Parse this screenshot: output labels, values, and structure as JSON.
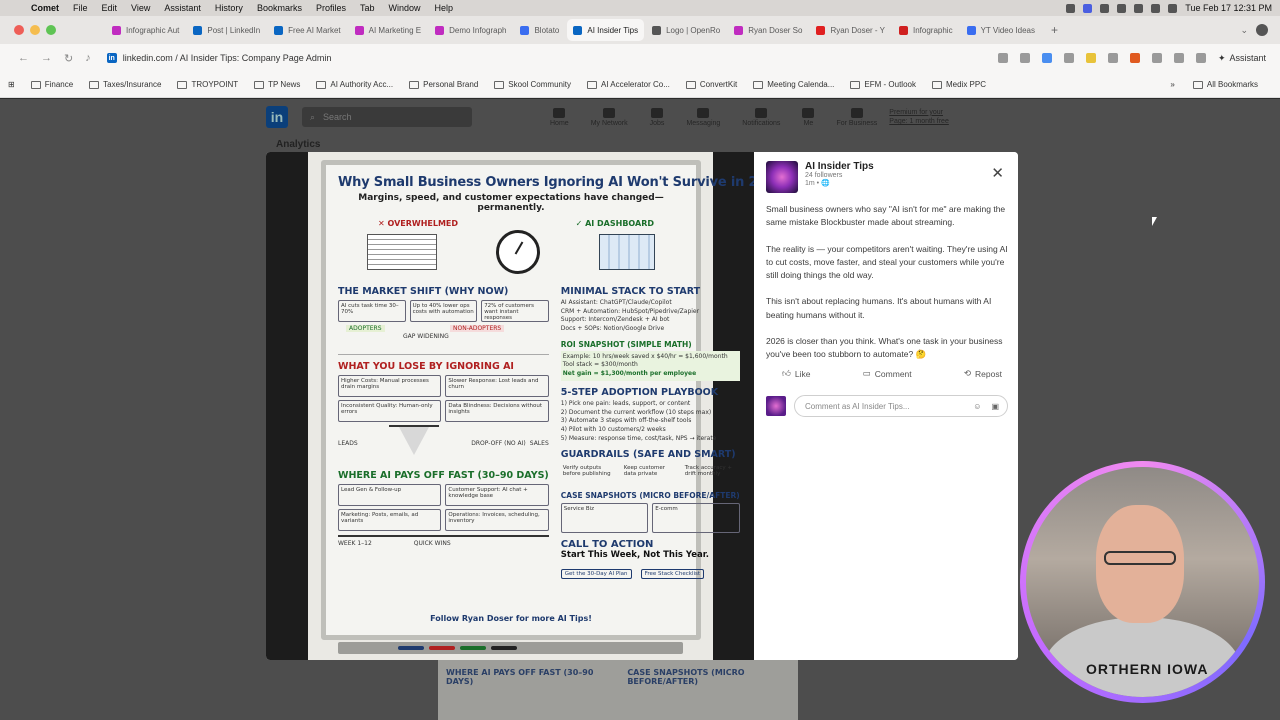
{
  "menubar": {
    "app": "Comet",
    "items": [
      "File",
      "Edit",
      "View",
      "Assistant",
      "History",
      "Bookmarks",
      "Profiles",
      "Tab",
      "Window",
      "Help"
    ],
    "clock": "Tue Feb 17  12:31 PM"
  },
  "tabs": [
    {
      "label": "Infographic Aut",
      "color": "#c02cc0"
    },
    {
      "label": "Post | LinkedIn",
      "color": "#0a66c2"
    },
    {
      "label": "Free AI Market",
      "color": "#0a66c2"
    },
    {
      "label": "AI Marketing E",
      "color": "#c02cc0"
    },
    {
      "label": "Demo Infograph",
      "color": "#c02cc0"
    },
    {
      "label": "Blotato",
      "color": "#3a6df0"
    },
    {
      "label": "AI Insider Tips",
      "color": "#0a66c2",
      "active": true
    },
    {
      "label": "Logo | OpenRo",
      "color": "#555555"
    },
    {
      "label": "Ryan Doser So",
      "color": "#c02cc0"
    },
    {
      "label": "Ryan Doser - Y",
      "color": "#e02020"
    },
    {
      "label": "Infographic",
      "color": "#d02020"
    },
    {
      "label": "YT Video Ideas",
      "color": "#3a6df0"
    }
  ],
  "url": "linkedin.com / AI Insider Tips: Company Page Admin",
  "assistant_label": "Assistant",
  "bookmarks": [
    "Finance",
    "Taxes/Insurance",
    "TROYPOINT",
    "TP News",
    "AI Authority Acc...",
    "Personal Brand",
    "Skool Community",
    "AI Accelerator Co...",
    "ConvertKit",
    "Meeting Calenda...",
    "EFM - Outlook",
    "Medix PPC"
  ],
  "all_bookmarks": "All Bookmarks",
  "linkedin": {
    "search_placeholder": "Search",
    "nav": [
      "Home",
      "My Network",
      "Jobs",
      "Messaging",
      "Notifications",
      "Me",
      "For Business"
    ],
    "premium_line1": "Premium for your",
    "premium_line2": "Page: 1 month free",
    "analytics": "Analytics"
  },
  "infographic": {
    "title": "Why Small Business Owners Ignoring AI Won't Survive in 2026",
    "subtitle": "Margins, speed, and customer expectations have changed—permanently.",
    "overwhelmed": "✕ OVERWHELMED",
    "dashboard": "✓ AI DASHBOARD",
    "market_shift": "THE MARKET SHIFT (WHY NOW)",
    "market_boxes": [
      "AI cuts task time 30–70%",
      "Up to 40% lower ops costs with automation",
      "72% of customers want instant responses"
    ],
    "adopters": "ADOPTERS",
    "gap": "GAP WIDENING",
    "non_adopters": "NON-ADOPTERS",
    "lose": "WHAT YOU LOSE BY IGNORING AI",
    "lose_boxes": [
      "Higher Costs: Manual processes drain margins",
      "Slower Response: Lost leads and churn",
      "Inconsistent Quality: Human-only errors",
      "Data Blindness: Decisions without insights"
    ],
    "leads": "LEADS",
    "dropoff": "DROP-OFF (NO AI)",
    "sales": "SALES",
    "pays_off": "WHERE AI PAYS OFF FAST (30–90 DAYS)",
    "pays_boxes": [
      "Lead Gen & Follow-up",
      "Customer Support: AI chat + knowledge base",
      "Marketing: Posts, emails, ad variants",
      "Operations: Invoices, scheduling, inventory"
    ],
    "week": "WEEK 1–12",
    "quick_wins": "QUICK WINS",
    "minimal": "MINIMAL STACK TO START",
    "minimal_items": [
      "AI Assistant: ChatGPT/Claude/Copilot",
      "CRM + Automation: HubSpot/Pipedrive/Zapier",
      "Support: Intercom/Zendesk + AI bot",
      "Docs + SOPs: Notion/Google Drive"
    ],
    "roi": "ROI SNAPSHOT (SIMPLE MATH)",
    "roi_example": "Example: 10 hrs/week saved x $40/hr = $1,600/month",
    "roi_stack": "Tool stack = $300/month",
    "roi_net": "Net gain = $1,300/month per employee",
    "playbook": "5-STEP ADOPTION PLAYBOOK",
    "playbook_items": [
      "1) Pick one pain: leads, support, or content",
      "2) Document the current workflow (10 steps max)",
      "3) Automate 3 steps with off-the-shelf tools",
      "4) Pilot with 10 customers/2 weeks",
      "5) Measure: response time, cost/task, NPS → iterate"
    ],
    "guardrails": "GUARDRAILS (SAFE AND SMART)",
    "guardrail_items": [
      "Verify outputs before publishing",
      "Keep customer data private",
      "Track accuracy + drift monthly"
    ],
    "case": "CASE SNAPSHOTS (MICRO BEFORE/AFTER)",
    "case_items": [
      "Service Biz",
      "E-comm"
    ],
    "cta": "CALL TO ACTION",
    "cta2": "Start This Week, Not This Year.",
    "cta_pills": [
      "Get the 30-Day AI Plan",
      "Free Stack Checklist"
    ],
    "footer": "Follow Ryan Doser for more AI Tips!"
  },
  "post": {
    "account": "AI Insider Tips",
    "followers": "24 followers",
    "time": "1m • 🌐",
    "paragraphs": [
      "Small business owners who say \"AI isn't for me\" are making the same mistake Blockbuster made about streaming.",
      "The reality is — your competitors aren't waiting. They're using AI to cut costs, move faster, and steal your customers while you're still doing things the old way.",
      "This isn't about replacing humans. It's about humans with AI beating humans without it.",
      "2026 is closer than you think. What's one task in your business you've been too stubborn to automate? 🤔"
    ],
    "actions": [
      "Like",
      "Comment",
      "Repost"
    ],
    "comment_placeholder": "Comment as AI Insider Tips..."
  },
  "webcam": {
    "shirt_text": "ORTHERN IOWA"
  },
  "peek": {
    "left": "WHERE AI PAYS OFF FAST (30–90 DAYS)",
    "right": "CASE SNAPSHOTS (MICRO BEFORE/AFTER)"
  }
}
